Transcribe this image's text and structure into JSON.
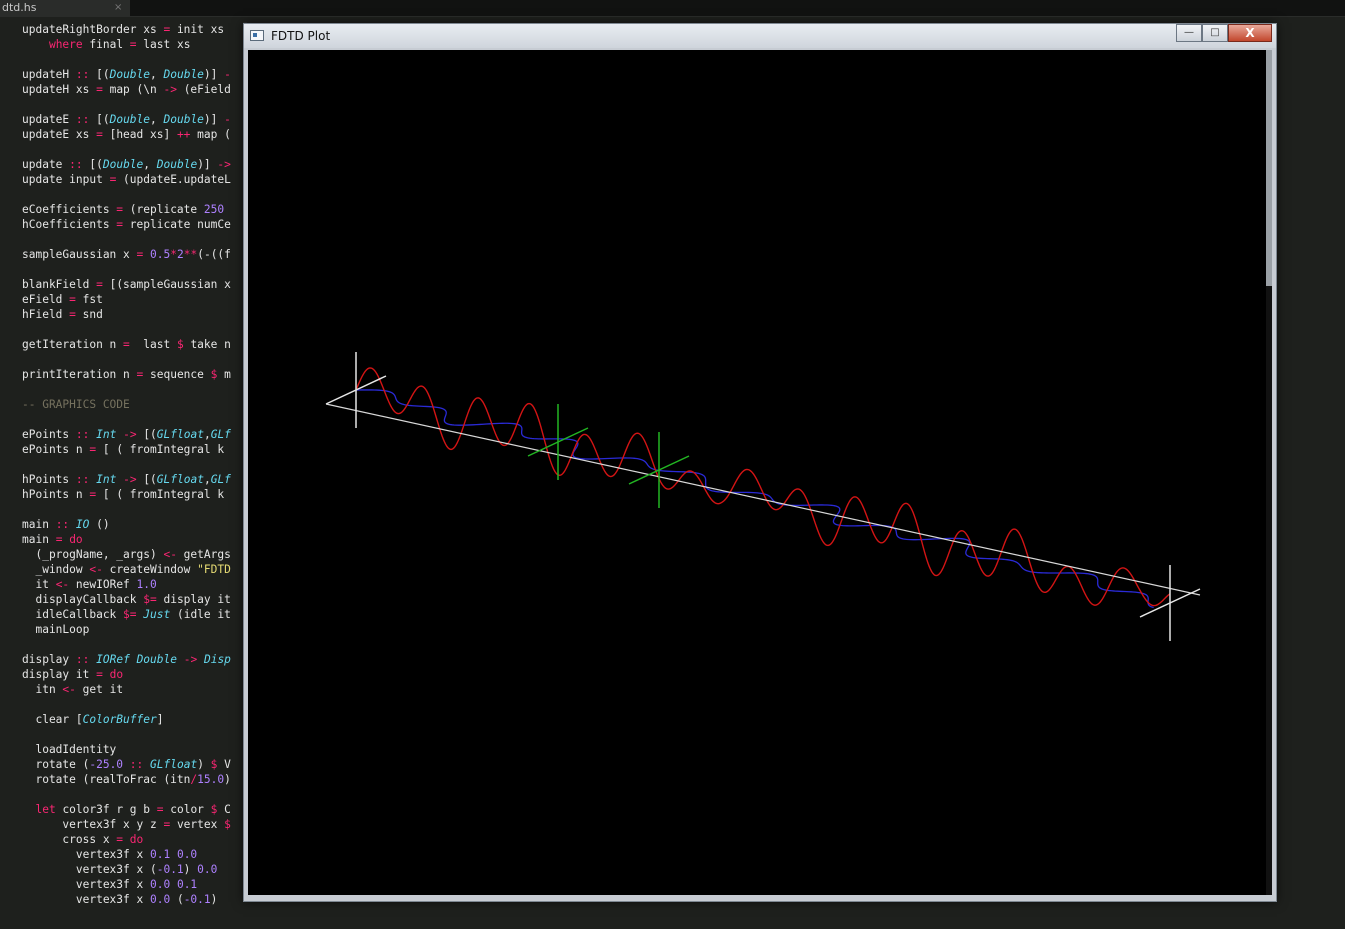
{
  "editor": {
    "tab": {
      "label": "dtd.hs",
      "close": "×"
    },
    "lines": [
      [
        {
          "t": "updateRightBorder xs "
        },
        {
          "t": "=",
          "c": "kw"
        },
        {
          "t": " init xs"
        }
      ],
      [
        {
          "t": "    "
        },
        {
          "t": "where",
          "c": "kw"
        },
        {
          "t": " final "
        },
        {
          "t": "=",
          "c": "kw"
        },
        {
          "t": " last xs"
        }
      ],
      [],
      [
        {
          "t": "updateH "
        },
        {
          "t": "::",
          "c": "kw"
        },
        {
          "t": " [("
        },
        {
          "t": "Double",
          "c": "ty"
        },
        {
          "t": ", "
        },
        {
          "t": "Double",
          "c": "ty"
        },
        {
          "t": ")] "
        },
        {
          "t": "-",
          "c": "kw"
        }
      ],
      [
        {
          "t": "updateH xs "
        },
        {
          "t": "=",
          "c": "kw"
        },
        {
          "t": " map (\\n "
        },
        {
          "t": "->",
          "c": "kw"
        },
        {
          "t": " (eField"
        }
      ],
      [],
      [
        {
          "t": "updateE "
        },
        {
          "t": "::",
          "c": "kw"
        },
        {
          "t": " [("
        },
        {
          "t": "Double",
          "c": "ty"
        },
        {
          "t": ", "
        },
        {
          "t": "Double",
          "c": "ty"
        },
        {
          "t": ")] "
        },
        {
          "t": "-",
          "c": "kw"
        }
      ],
      [
        {
          "t": "updateE xs "
        },
        {
          "t": "=",
          "c": "kw"
        },
        {
          "t": " [head xs] "
        },
        {
          "t": "++",
          "c": "kw"
        },
        {
          "t": " map ("
        }
      ],
      [],
      [
        {
          "t": "update "
        },
        {
          "t": "::",
          "c": "kw"
        },
        {
          "t": " [("
        },
        {
          "t": "Double",
          "c": "ty"
        },
        {
          "t": ", "
        },
        {
          "t": "Double",
          "c": "ty"
        },
        {
          "t": ")] "
        },
        {
          "t": "->",
          "c": "kw"
        }
      ],
      [
        {
          "t": "update input "
        },
        {
          "t": "=",
          "c": "kw"
        },
        {
          "t": " (updateE.updateL"
        }
      ],
      [],
      [
        {
          "t": "eCoefficients "
        },
        {
          "t": "=",
          "c": "kw"
        },
        {
          "t": " (replicate "
        },
        {
          "t": "250",
          "c": "num"
        }
      ],
      [
        {
          "t": "hCoefficients "
        },
        {
          "t": "=",
          "c": "kw"
        },
        {
          "t": " replicate numCe"
        }
      ],
      [],
      [
        {
          "t": "sampleGaussian x "
        },
        {
          "t": "=",
          "c": "kw"
        },
        {
          "t": " "
        },
        {
          "t": "0.5",
          "c": "num"
        },
        {
          "t": "*",
          "c": "kw"
        },
        {
          "t": "2",
          "c": "num"
        },
        {
          "t": "**",
          "c": "kw"
        },
        {
          "t": "(-((f"
        }
      ],
      [],
      [
        {
          "t": "blankField "
        },
        {
          "t": "=",
          "c": "kw"
        },
        {
          "t": " [(sampleGaussian x"
        }
      ],
      [
        {
          "t": "eField "
        },
        {
          "t": "=",
          "c": "kw"
        },
        {
          "t": " fst"
        }
      ],
      [
        {
          "t": "hField "
        },
        {
          "t": "=",
          "c": "kw"
        },
        {
          "t": " snd"
        }
      ],
      [],
      [
        {
          "t": "getIteration n "
        },
        {
          "t": "=",
          "c": "kw"
        },
        {
          "t": "  last "
        },
        {
          "t": "$",
          "c": "kw"
        },
        {
          "t": " take n"
        }
      ],
      [],
      [
        {
          "t": "printIteration n "
        },
        {
          "t": "=",
          "c": "kw"
        },
        {
          "t": " sequence "
        },
        {
          "t": "$",
          "c": "kw"
        },
        {
          "t": " m"
        }
      ],
      [],
      [
        {
          "t": "-- GRAPHICS CODE",
          "c": "cm"
        }
      ],
      [],
      [
        {
          "t": "ePoints "
        },
        {
          "t": "::",
          "c": "kw"
        },
        {
          "t": " "
        },
        {
          "t": "Int",
          "c": "ty"
        },
        {
          "t": " "
        },
        {
          "t": "->",
          "c": "kw"
        },
        {
          "t": " [("
        },
        {
          "t": "GLfloat",
          "c": "ty"
        },
        {
          "t": ","
        },
        {
          "t": "GLf",
          "c": "ty"
        }
      ],
      [
        {
          "t": "ePoints n "
        },
        {
          "t": "=",
          "c": "kw"
        },
        {
          "t": " [ ( fromIntegral k"
        }
      ],
      [],
      [
        {
          "t": "hPoints "
        },
        {
          "t": "::",
          "c": "kw"
        },
        {
          "t": " "
        },
        {
          "t": "Int",
          "c": "ty"
        },
        {
          "t": " "
        },
        {
          "t": "->",
          "c": "kw"
        },
        {
          "t": " [("
        },
        {
          "t": "GLfloat",
          "c": "ty"
        },
        {
          "t": ","
        },
        {
          "t": "GLf",
          "c": "ty"
        }
      ],
      [
        {
          "t": "hPoints n "
        },
        {
          "t": "=",
          "c": "kw"
        },
        {
          "t": " [ ( fromIntegral k"
        }
      ],
      [],
      [
        {
          "t": "main "
        },
        {
          "t": "::",
          "c": "kw"
        },
        {
          "t": " "
        },
        {
          "t": "IO",
          "c": "ty"
        },
        {
          "t": " ()"
        }
      ],
      [
        {
          "t": "main "
        },
        {
          "t": "=",
          "c": "kw"
        },
        {
          "t": " "
        },
        {
          "t": "do",
          "c": "kw"
        }
      ],
      [
        {
          "t": "  (_progName, _args) "
        },
        {
          "t": "<-",
          "c": "kw"
        },
        {
          "t": " getArgs"
        }
      ],
      [
        {
          "t": "  _window "
        },
        {
          "t": "<-",
          "c": "kw"
        },
        {
          "t": " createWindow "
        },
        {
          "t": "\"FDTD",
          "c": "str"
        }
      ],
      [
        {
          "t": "  it "
        },
        {
          "t": "<-",
          "c": "kw"
        },
        {
          "t": " newIORef "
        },
        {
          "t": "1.0",
          "c": "num"
        }
      ],
      [
        {
          "t": "  displayCallback "
        },
        {
          "t": "$=",
          "c": "kw"
        },
        {
          "t": " display it"
        }
      ],
      [
        {
          "t": "  idleCallback "
        },
        {
          "t": "$=",
          "c": "kw"
        },
        {
          "t": " "
        },
        {
          "t": "Just",
          "c": "ty"
        },
        {
          "t": " (idle it"
        }
      ],
      [
        {
          "t": "  mainLoop"
        }
      ],
      [],
      [
        {
          "t": "display "
        },
        {
          "t": "::",
          "c": "kw"
        },
        {
          "t": " "
        },
        {
          "t": "IORef",
          "c": "ty"
        },
        {
          "t": " "
        },
        {
          "t": "Double",
          "c": "ty"
        },
        {
          "t": " "
        },
        {
          "t": "->",
          "c": "kw"
        },
        {
          "t": " "
        },
        {
          "t": "Disp",
          "c": "ty"
        }
      ],
      [
        {
          "t": "display it "
        },
        {
          "t": "=",
          "c": "kw"
        },
        {
          "t": " "
        },
        {
          "t": "do",
          "c": "kw"
        }
      ],
      [
        {
          "t": "  itn "
        },
        {
          "t": "<-",
          "c": "kw"
        },
        {
          "t": " get it"
        }
      ],
      [],
      [
        {
          "t": "  clear ["
        },
        {
          "t": "ColorBuffer",
          "c": "ty"
        },
        {
          "t": "]"
        }
      ],
      [],
      [
        {
          "t": "  loadIdentity"
        }
      ],
      [
        {
          "t": "  rotate ("
        },
        {
          "t": "-25.0",
          "c": "num"
        },
        {
          "t": " "
        },
        {
          "t": "::",
          "c": "kw"
        },
        {
          "t": " "
        },
        {
          "t": "GLfloat",
          "c": "ty"
        },
        {
          "t": ") "
        },
        {
          "t": "$",
          "c": "kw"
        },
        {
          "t": " V"
        }
      ],
      [
        {
          "t": "  rotate (realToFrac (itn"
        },
        {
          "t": "/",
          "c": "kw"
        },
        {
          "t": "15.0",
          "c": "num"
        },
        {
          "t": ")"
        }
      ],
      [],
      [
        {
          "t": "  "
        },
        {
          "t": "let",
          "c": "kw"
        },
        {
          "t": " color3f r g b "
        },
        {
          "t": "=",
          "c": "kw"
        },
        {
          "t": " color "
        },
        {
          "t": "$",
          "c": "kw"
        },
        {
          "t": " C"
        }
      ],
      [
        {
          "t": "      vertex3f x y z "
        },
        {
          "t": "=",
          "c": "kw"
        },
        {
          "t": " vertex "
        },
        {
          "t": "$",
          "c": "kw"
        }
      ],
      [
        {
          "t": "      cross x "
        },
        {
          "t": "=",
          "c": "kw"
        },
        {
          "t": " "
        },
        {
          "t": "do",
          "c": "kw"
        }
      ],
      [
        {
          "t": "        vertex3f x "
        },
        {
          "t": "0.1",
          "c": "num"
        },
        {
          "t": " "
        },
        {
          "t": "0.0",
          "c": "num"
        }
      ],
      [
        {
          "t": "        vertex3f x ("
        },
        {
          "t": "-0.1",
          "c": "num"
        },
        {
          "t": ") "
        },
        {
          "t": "0.0",
          "c": "num"
        }
      ],
      [
        {
          "t": "        vertex3f x "
        },
        {
          "t": "0.0",
          "c": "num"
        },
        {
          "t": " "
        },
        {
          "t": "0.1",
          "c": "num"
        }
      ],
      [
        {
          "t": "        vertex3f x "
        },
        {
          "t": "0.0",
          "c": "num"
        },
        {
          "t": " ("
        },
        {
          "t": "-0.1",
          "c": "num"
        },
        {
          "t": ")"
        }
      ]
    ]
  },
  "window": {
    "title": "FDTD Plot",
    "controls": {
      "minimize": "—",
      "maximize": "□",
      "close": "X"
    }
  },
  "colors": {
    "axis": "#d8d8d8",
    "e_field": "#d21414",
    "h_field": "#2a2ad6",
    "markers_green": "#22b522",
    "markers_white": "#e6e6e6"
  }
}
